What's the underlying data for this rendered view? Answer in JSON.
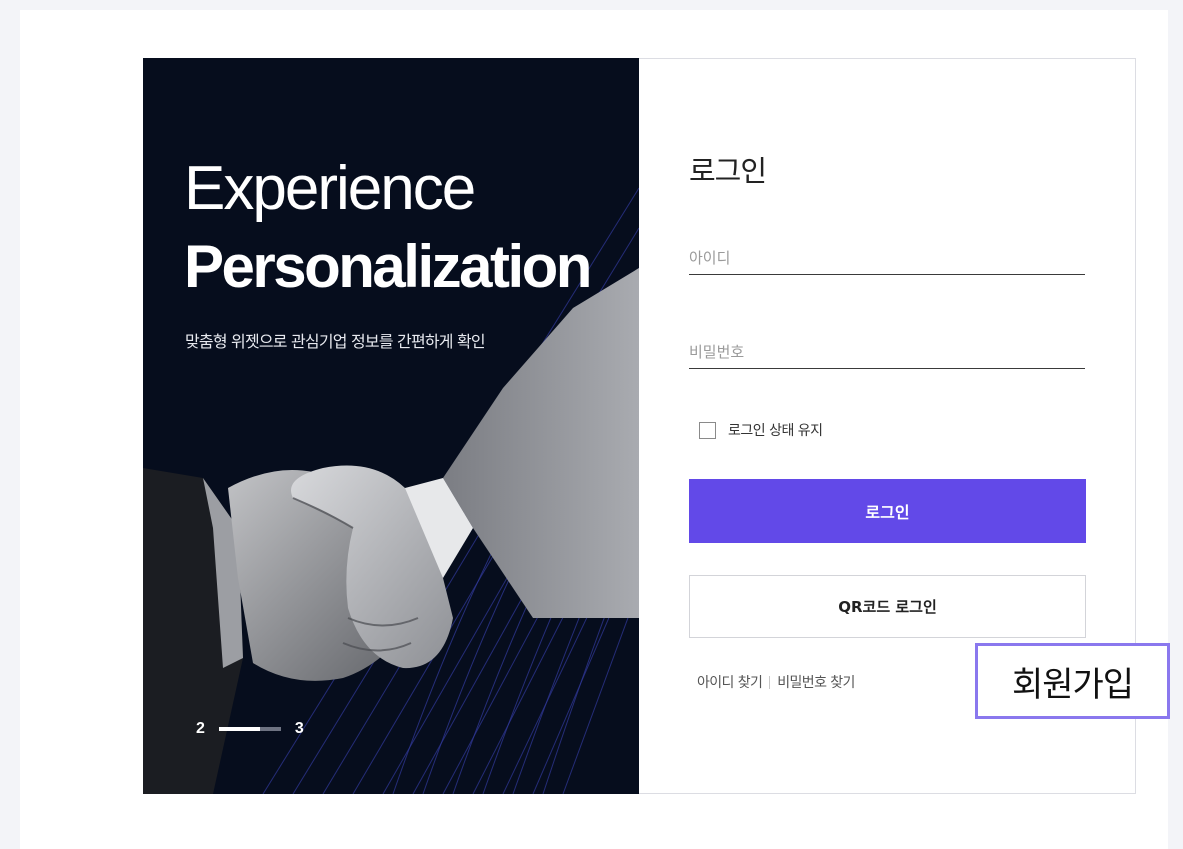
{
  "banner": {
    "headline_line1": "Experience",
    "headline_line2": "Personalization",
    "subtitle": "맞춤형 위젯으로 관심기업 정보를 간편하게 확인",
    "pager": {
      "current": "2",
      "total": "3",
      "progress": 0.67
    }
  },
  "login": {
    "title": "로그인",
    "id_placeholder": "아이디",
    "password_placeholder": "비밀번호",
    "keep_signed_in_label": "로그인 상태 유지",
    "login_button_label": "로그인",
    "qr_button_label": "QR코드 로그인",
    "find_id_label": "아이디 찾기",
    "find_password_label": "비밀번호 찾기",
    "signup_label": "회원가입"
  },
  "colors": {
    "primary": "#6249e8",
    "banner_bg": "#060d1d",
    "signup_border": "#8a78ee"
  }
}
